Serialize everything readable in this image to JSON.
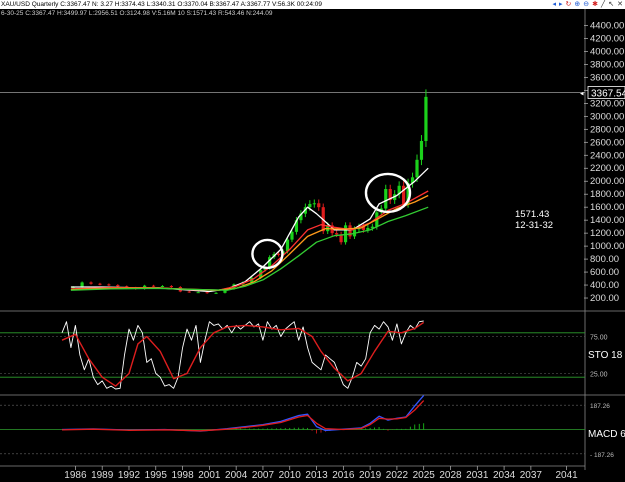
{
  "header": {
    "title": "XAU/USD Quarterly C:3367.47 N: 3.27 H:3374.43 L:3340.31 O:3370.04 B:3367.47 A:3367.77 V:56.3K 00:24:09",
    "subtitle": "6-30-25 C:3367.47 H:3499.97 L:2956.51 O:3124.98 V:5.16M 10 S:1571.43 R:543.46 N:244.09"
  },
  "toolbar_icons": [
    {
      "name": "scroll-left-icon",
      "glyph": "◂",
      "color": "#1e5bd6"
    },
    {
      "name": "scroll-right-icon",
      "glyph": "▸",
      "color": "#1e5bd6"
    },
    {
      "name": "redraw-icon",
      "glyph": "↻",
      "color": "#d21e1e"
    },
    {
      "name": "zoom-in-icon",
      "glyph": "⊕",
      "color": "#1e5bd6"
    },
    {
      "name": "zoom-out-icon",
      "glyph": "⊖",
      "color": "#1e5bd6"
    },
    {
      "name": "settings-icon",
      "glyph": "✱",
      "color": "#d21e1e"
    },
    {
      "name": "draw-line-icon",
      "glyph": "╱",
      "color": "#333333"
    },
    {
      "name": "cursor-icon",
      "glyph": "↖",
      "color": "#333333"
    },
    {
      "name": "close-icon",
      "glyph": "✕",
      "color": "#333333"
    }
  ],
  "colors": {
    "background": "#000000",
    "candle_up": "#1bd21b",
    "candle_down": "#e01c1c",
    "ma_fast": "#ffffff",
    "ma_mid": "#ff3030",
    "ma_orange": "#ff9a1a",
    "ma_slow": "#33cc33",
    "stoch_k": "#ffffff",
    "stoch_d": "#dd1e1e",
    "guide": "#2e9e2e",
    "macd": "#3355ff",
    "macd_signal": "#e01c1c",
    "axis_text": "#dddddd"
  },
  "chart_data": [
    {
      "type": "candlestick",
      "title": "XAU/USD Quarterly",
      "y_range": [
        0,
        4500
      ],
      "y_ticks": [
        "200.00",
        "400.00",
        "600.00",
        "800.00",
        "1000.00",
        "1200.00",
        "1400.00",
        "1600.00",
        "1800.00",
        "2000.00",
        "2200.00",
        "2400.00",
        "2600.00",
        "2800.00",
        "3000.00",
        "3200.00",
        "3400.00",
        "3600.00",
        "3800.00",
        "4000.00",
        "4200.00",
        "4400.00"
      ],
      "x_ticks": [
        "1986",
        "1989",
        "1992",
        "1995",
        "1998",
        "2001",
        "2004",
        "2007",
        "2010",
        "2013",
        "2016",
        "2019",
        "2022",
        "2025",
        "2028",
        "2031",
        "2034",
        "2037",
        "2041"
      ],
      "last_price_label": "3367.54",
      "last_price": 3367.5,
      "annotation": [
        "1571.43",
        "12-31-32"
      ],
      "highlight_circles": [
        {
          "year": 2007.5,
          "price": 880
        },
        {
          "year": 2021.0,
          "price": 1820
        }
      ],
      "candles_year": [
        1985.75,
        1986.75,
        1987.75,
        1988.75,
        1989.75,
        1990.75,
        1991.75,
        1992.75,
        1993.75,
        1994.75,
        1995.75,
        1996.75,
        1997.75,
        1998.75,
        1999.75,
        2000.75,
        2001.75,
        2002.75,
        2003.75,
        2004.75,
        2005.75,
        2006.75,
        2007.25,
        2007.75,
        2008.25,
        2008.75,
        2009.25,
        2009.75,
        2010.25,
        2010.75,
        2011.25,
        2011.75,
        2012.25,
        2012.75,
        2013.25,
        2013.75,
        2014.25,
        2014.75,
        2015.25,
        2015.75,
        2016.25,
        2016.75,
        2017.25,
        2017.75,
        2018.25,
        2018.75,
        2019.25,
        2019.75,
        2020.25,
        2020.75,
        2021.25,
        2021.75,
        2022.25,
        2022.75,
        2023.25,
        2023.75,
        2024.25,
        2024.75,
        2025.25
      ],
      "candles_close": [
        370,
        440,
        420,
        410,
        400,
        380,
        360,
        340,
        390,
        380,
        385,
        370,
        300,
        290,
        290,
        275,
        280,
        340,
        410,
        440,
        510,
        630,
        660,
        830,
        880,
        870,
        920,
        1100,
        1220,
        1400,
        1500,
        1600,
        1650,
        1660,
        1600,
        1230,
        1320,
        1200,
        1180,
        1060,
        1320,
        1150,
        1260,
        1300,
        1250,
        1280,
        1300,
        1520,
        1580,
        1880,
        1710,
        1800,
        1930,
        1650,
        1970,
        2060,
        2330,
        2620,
        3300
      ],
      "series": [
        {
          "name": "ma_fast",
          "x": [
            1985.5,
            1989,
            1992,
            1995,
            1998,
            2001,
            2003,
            2005,
            2007,
            2009,
            2011,
            2012,
            2013,
            2015,
            2017,
            2019,
            2020,
            2022,
            2024,
            2025.5
          ],
          "values": [
            370,
            370,
            360,
            360,
            330,
            300,
            340,
            450,
            680,
            950,
            1450,
            1600,
            1500,
            1250,
            1250,
            1420,
            1650,
            1780,
            2000,
            2200
          ]
        },
        {
          "name": "ma_mid",
          "x": [
            1985.5,
            1990,
            1995,
            1999,
            2002,
            2004,
            2006,
            2008,
            2010,
            2012,
            2013.5,
            2015,
            2017,
            2019,
            2021,
            2023,
            2025.5
          ],
          "values": [
            340,
            360,
            360,
            330,
            320,
            380,
            500,
            700,
            950,
            1250,
            1330,
            1290,
            1250,
            1360,
            1550,
            1660,
            1850
          ]
        },
        {
          "name": "ma_orange",
          "x": [
            1985.5,
            1990,
            1995,
            1999,
            2002,
            2004,
            2006,
            2008,
            2010,
            2012,
            2014,
            2016,
            2018,
            2020,
            2022,
            2024,
            2025.5
          ],
          "values": [
            330,
            350,
            355,
            335,
            320,
            350,
            450,
            620,
            880,
            1150,
            1270,
            1260,
            1280,
            1430,
            1580,
            1680,
            1780
          ]
        },
        {
          "name": "ma_slow",
          "x": [
            1985.5,
            1990,
            1995,
            2000,
            2003,
            2005,
            2007,
            2009,
            2011,
            2013,
            2015,
            2017,
            2019,
            2021,
            2023,
            2025.5
          ],
          "values": [
            320,
            340,
            350,
            330,
            320,
            380,
            480,
            650,
            850,
            1060,
            1160,
            1190,
            1250,
            1380,
            1470,
            1600
          ]
        }
      ]
    },
    {
      "type": "line",
      "title": "STO",
      "label": "STO  18",
      "y_range": [
        0,
        100
      ],
      "y_ticks": [
        "75.00",
        "25.00"
      ],
      "guides": [
        80,
        20
      ],
      "series": [
        {
          "name": "stoch_k",
          "x": [
            1984.5,
            1985,
            1985.5,
            1986,
            1986.5,
            1987,
            1987.5,
            1988,
            1988.5,
            1989,
            1989.5,
            1990,
            1990.5,
            1991,
            1991.5,
            1992,
            1992.5,
            1993,
            1993.5,
            1994,
            1994.5,
            1995,
            1995.5,
            1996,
            1996.5,
            1997,
            1997.5,
            1998,
            1998.5,
            1999,
            1999.5,
            2000,
            2000.5,
            2001,
            2001.5,
            2002,
            2002.5,
            2003,
            2003.5,
            2004,
            2004.5,
            2005,
            2005.5,
            2006,
            2006.5,
            2007,
            2007.5,
            2008,
            2008.5,
            2009,
            2009.5,
            2010,
            2010.5,
            2011,
            2011.5,
            2012,
            2012.5,
            2013,
            2013.5,
            2014,
            2014.5,
            2015,
            2015.5,
            2016,
            2016.5,
            2017,
            2017.5,
            2018,
            2018.5,
            2019,
            2019.5,
            2020,
            2020.5,
            2021,
            2021.5,
            2022,
            2022.5,
            2023,
            2023.5,
            2024,
            2024.5,
            2025
          ],
          "values": [
            80,
            95,
            60,
            90,
            50,
            30,
            45,
            20,
            10,
            15,
            5,
            8,
            4,
            5,
            50,
            85,
            70,
            90,
            80,
            40,
            45,
            25,
            20,
            8,
            10,
            5,
            20,
            60,
            85,
            70,
            90,
            40,
            70,
            95,
            90,
            92,
            85,
            90,
            80,
            90,
            85,
            90,
            95,
            88,
            92,
            70,
            95,
            85,
            90,
            75,
            85,
            90,
            95,
            70,
            88,
            60,
            40,
            35,
            30,
            50,
            45,
            40,
            25,
            10,
            5,
            20,
            40,
            35,
            45,
            80,
            90,
            85,
            95,
            88,
            70,
            92,
            65,
            80,
            90,
            85,
            95,
            96
          ]
        },
        {
          "name": "stoch_d",
          "x": [
            1984.5,
            1986,
            1987.5,
            1989,
            1990.5,
            1992,
            1993,
            1994,
            1995.5,
            1997,
            1998.5,
            2000,
            2001.5,
            2003,
            2005,
            2007,
            2009,
            2011,
            2012.5,
            2013.5,
            2015,
            2016.5,
            2018,
            2019.5,
            2021,
            2022.5,
            2024,
            2025
          ],
          "values": [
            70,
            78,
            45,
            20,
            8,
            25,
            65,
            75,
            55,
            18,
            25,
            60,
            80,
            88,
            90,
            88,
            84,
            86,
            75,
            55,
            32,
            15,
            25,
            55,
            82,
            80,
            86,
            94
          ]
        }
      ]
    },
    {
      "type": "line",
      "title": "MACD",
      "label": "MACD 6",
      "y_range": [
        -250,
        250
      ],
      "y_ticks": [
        "187.26",
        "- 187.26"
      ],
      "series": [
        {
          "name": "macd",
          "x": [
            1984.5,
            1988,
            1992,
            1996,
            2000,
            2003,
            2005,
            2007,
            2009,
            2011,
            2012,
            2013,
            2014,
            2016,
            2018,
            2019,
            2020,
            2021,
            2022,
            2023,
            2024,
            2025
          ],
          "values": [
            0,
            5,
            -4,
            0,
            -12,
            6,
            22,
            38,
            62,
            108,
            118,
            22,
            -8,
            2,
            12,
            48,
            102,
            72,
            86,
            96,
            182,
            262
          ]
        },
        {
          "name": "macd_signal",
          "x": [
            1984.5,
            1988,
            1992,
            1996,
            2000,
            2003,
            2005,
            2007,
            2009,
            2011,
            2012,
            2013,
            2014,
            2016,
            2018,
            2019,
            2020,
            2021,
            2022,
            2023,
            2024,
            2025
          ],
          "values": [
            -3,
            2,
            -6,
            -2,
            -10,
            2,
            16,
            32,
            54,
            96,
            108,
            48,
            6,
            0,
            8,
            38,
            86,
            80,
            82,
            92,
            150,
            222
          ]
        }
      ]
    }
  ]
}
